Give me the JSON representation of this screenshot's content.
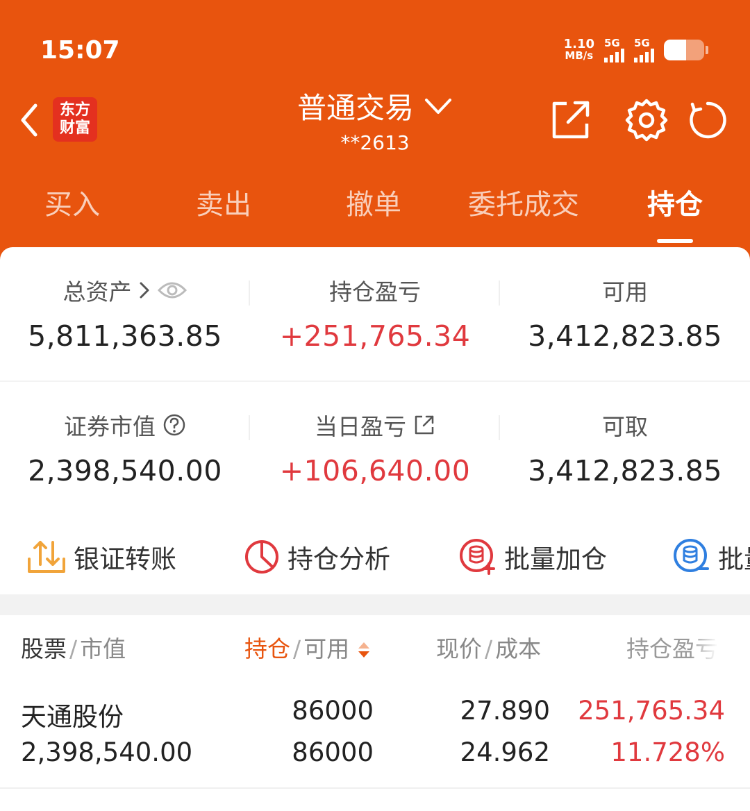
{
  "status_bar": {
    "time": "15:07",
    "net_speed_value": "1.10",
    "net_speed_unit": "MB/s",
    "sim1_label": "5G",
    "sim2_label": "5G"
  },
  "header": {
    "logo_line1": "东方",
    "logo_line2": "财富",
    "title": "普通交易",
    "account": "**2613"
  },
  "tabs": [
    {
      "label": "买入"
    },
    {
      "label": "卖出"
    },
    {
      "label": "撤单"
    },
    {
      "label": "委托成交"
    },
    {
      "label": "持仓"
    }
  ],
  "summary": {
    "total_assets": {
      "label": "总资产",
      "value": "5,811,363.85"
    },
    "position_pnl": {
      "label": "持仓盈亏",
      "value": "+251,765.34"
    },
    "available": {
      "label": "可用",
      "value": "3,412,823.85"
    },
    "market_value": {
      "label": "证券市值",
      "value": "2,398,540.00"
    },
    "daily_pnl": {
      "label": "当日盈亏",
      "value": "+106,640.00"
    },
    "withdrawable": {
      "label": "可取",
      "value": "3,412,823.85"
    }
  },
  "actions": [
    {
      "label": "银证转账"
    },
    {
      "label": "持仓分析"
    },
    {
      "label": "批量加仓"
    },
    {
      "label": "批量"
    }
  ],
  "list_header": {
    "stock": "股票",
    "market_value": "市值",
    "position": "持仓",
    "available": "可用",
    "price": "现价",
    "cost": "成本",
    "pnl": "持仓盈亏"
  },
  "holdings": [
    {
      "name": "天通股份",
      "market_value": "2,398,540.00",
      "position": "86000",
      "available": "86000",
      "price": "27.890",
      "cost": "24.962",
      "pnl": "251,765.34",
      "pnl_pct": "11.728%"
    }
  ],
  "colors": {
    "brand": "#e8540e",
    "profit": "#e0393e"
  }
}
